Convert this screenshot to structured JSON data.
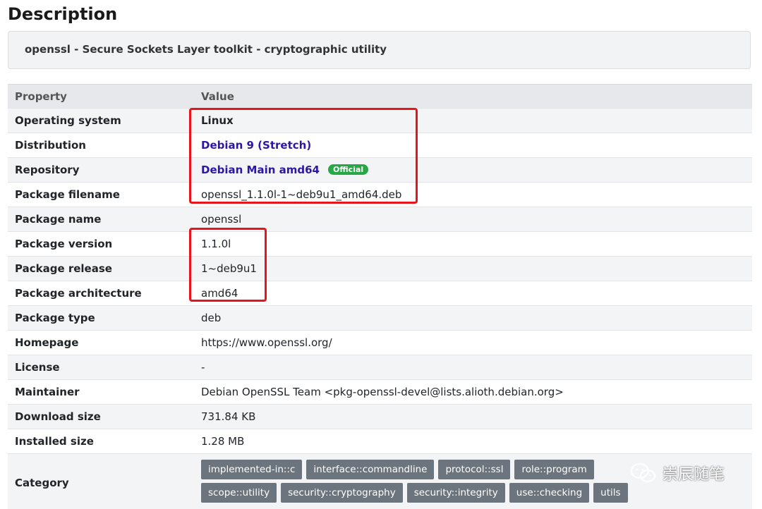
{
  "heading": "Description",
  "summary": "openssl - Secure Sockets Layer toolkit - cryptographic utility",
  "table": {
    "header_property": "Property",
    "header_value": "Value"
  },
  "rows": [
    {
      "property": "Operating system",
      "value": "Linux"
    },
    {
      "property": "Distribution",
      "value": "Debian 9 (Stretch)"
    },
    {
      "property": "Repository",
      "value": "Debian Main amd64",
      "badge": "Official"
    },
    {
      "property": "Package filename",
      "value": "openssl_1.1.0l-1~deb9u1_amd64.deb"
    },
    {
      "property": "Package name",
      "value": "openssl"
    },
    {
      "property": "Package version",
      "value": "1.1.0l"
    },
    {
      "property": "Package release",
      "value": "1~deb9u1"
    },
    {
      "property": "Package architecture",
      "value": "amd64"
    },
    {
      "property": "Package type",
      "value": "deb"
    },
    {
      "property": "Homepage",
      "value": "https://www.openssl.org/"
    },
    {
      "property": "License",
      "value": "-"
    },
    {
      "property": "Maintainer",
      "value": "Debian OpenSSL Team <pkg-openssl-devel@lists.alioth.debian.org>"
    },
    {
      "property": "Download size",
      "value": "731.84 KB"
    },
    {
      "property": "Installed size",
      "value": "1.28 MB"
    }
  ],
  "category": {
    "label": "Category",
    "tags": [
      "implemented-in::c",
      "interface::commandline",
      "protocol::ssl",
      "role::program",
      "scope::utility",
      "security::cryptography",
      "security::integrity",
      "use::checking",
      "utils"
    ]
  },
  "watermark": "崇辰随笔",
  "colors": {
    "link": "#2d17a5",
    "badge": "#28a745",
    "tag": "#6c757d",
    "highlight": "#e8141c"
  }
}
